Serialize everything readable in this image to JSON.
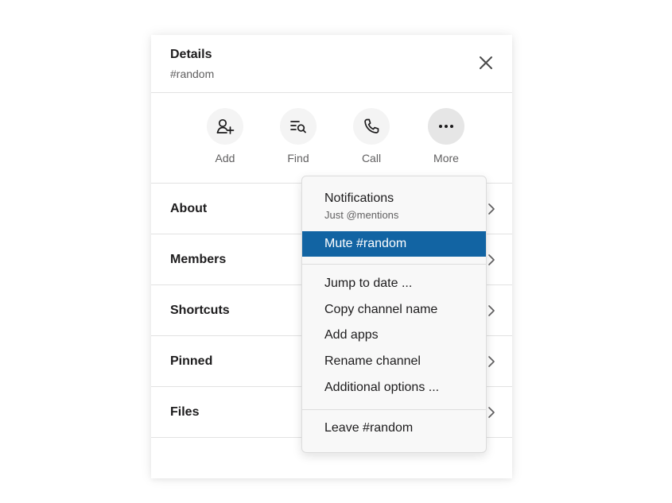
{
  "header": {
    "title": "Details",
    "subtitle": "#random"
  },
  "actions": [
    {
      "label": "Add",
      "icon": "add-user-icon"
    },
    {
      "label": "Find",
      "icon": "search-list-icon"
    },
    {
      "label": "Call",
      "icon": "phone-icon"
    },
    {
      "label": "More",
      "icon": "more-icon"
    }
  ],
  "rows": [
    {
      "label": "About"
    },
    {
      "label": "Members"
    },
    {
      "label": "Shortcuts"
    },
    {
      "label": "Pinned"
    },
    {
      "label": "Files"
    }
  ],
  "menu": {
    "notifications": {
      "label": "Notifications",
      "sub": "Just @mentions"
    },
    "mute": "Mute #random",
    "jump": "Jump to date ...",
    "copy": "Copy channel name",
    "apps": "Add apps",
    "rename": "Rename channel",
    "additional": "Additional options ...",
    "leave": "Leave #random"
  },
  "colors": {
    "highlight": "#1264a3",
    "text": "#1d1c1d",
    "muted": "#616061"
  }
}
